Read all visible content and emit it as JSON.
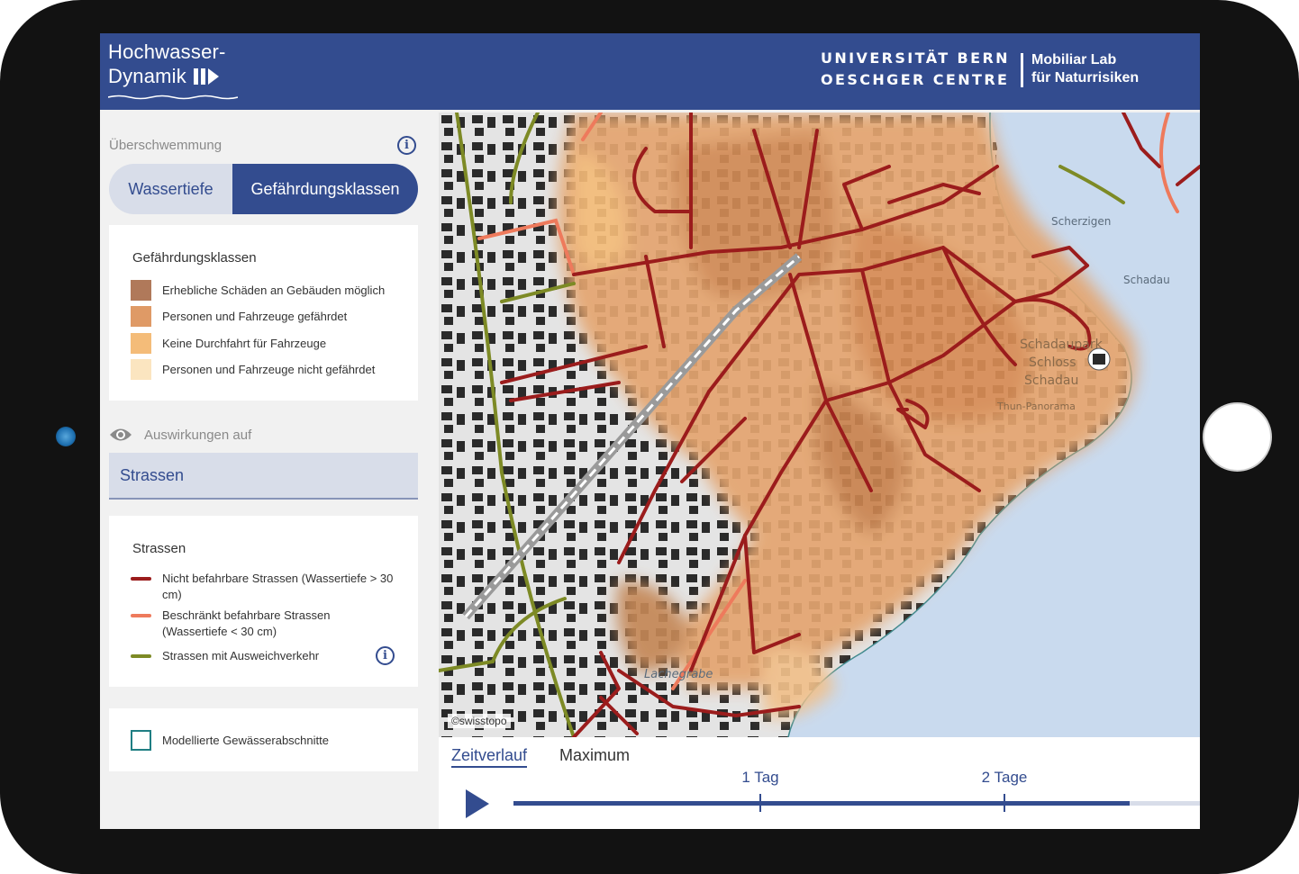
{
  "header": {
    "brand_line1": "Hochwasser-",
    "brand_line2": "Dynamik",
    "university_line1": "UNIVERSITÄT BERN",
    "university_line2": "OESCHGER CENTRE",
    "lab_line1": "Mobiliar Lab",
    "lab_line2": "für Naturrisiken"
  },
  "sidebar": {
    "section_title": "Überschwemmung",
    "toggle": {
      "options": [
        "Wassertiefe",
        "Gefährdungsklassen"
      ],
      "selected": "Gefährdungsklassen"
    },
    "hazard_legend": {
      "title": "Gefährdungsklassen",
      "items": [
        {
          "label": "Erhebliche Schäden an Gebäuden möglich",
          "color": "#b0795a"
        },
        {
          "label": "Personen und Fahrzeuge gefährdet",
          "color": "#df9a66"
        },
        {
          "label": "Keine Durchfahrt für Fahrzeuge",
          "color": "#f4bc79"
        },
        {
          "label": "Personen und Fahrzeuge nicht gefährdet",
          "color": "#fbe5c0"
        }
      ]
    },
    "effects_label": "Auswirkungen auf",
    "effects_select": {
      "value": "Strassen"
    },
    "roads_legend": {
      "title": "Strassen",
      "items": [
        {
          "label": "Nicht befahrbare Strassen (Wassertiefe > 30 cm)",
          "color": "#9b1c1c"
        },
        {
          "label": "Beschränkt befahrbare Strassen (Wassertiefe < 30 cm)",
          "color": "#ee7a5c"
        },
        {
          "label": "Strassen mit Ausweichverkehr",
          "color": "#7d8a25"
        }
      ]
    },
    "modeled_checkbox": {
      "label": "Modellierte Gewässerabschnitte",
      "checked": false
    }
  },
  "map": {
    "copyright": "©swisstopo",
    "place_labels": [
      "Scherzigen",
      "Schadau",
      "Schadaupark",
      "Schloss",
      "Schadau",
      "Thun-Panorama",
      "Lachegrabe"
    ]
  },
  "timeline": {
    "tabs": [
      "Zeitverlauf",
      "Maximum"
    ],
    "active_tab": "Zeitverlauf",
    "ticks": [
      "1 Tag",
      "2 Tage"
    ],
    "progress_fraction": 0.898
  },
  "colors": {
    "primary": "#334c8f",
    "water": "#c9daee",
    "road_closed": "#9b1c1c",
    "road_limited": "#ee7a5c",
    "road_detour": "#7d8a25"
  }
}
